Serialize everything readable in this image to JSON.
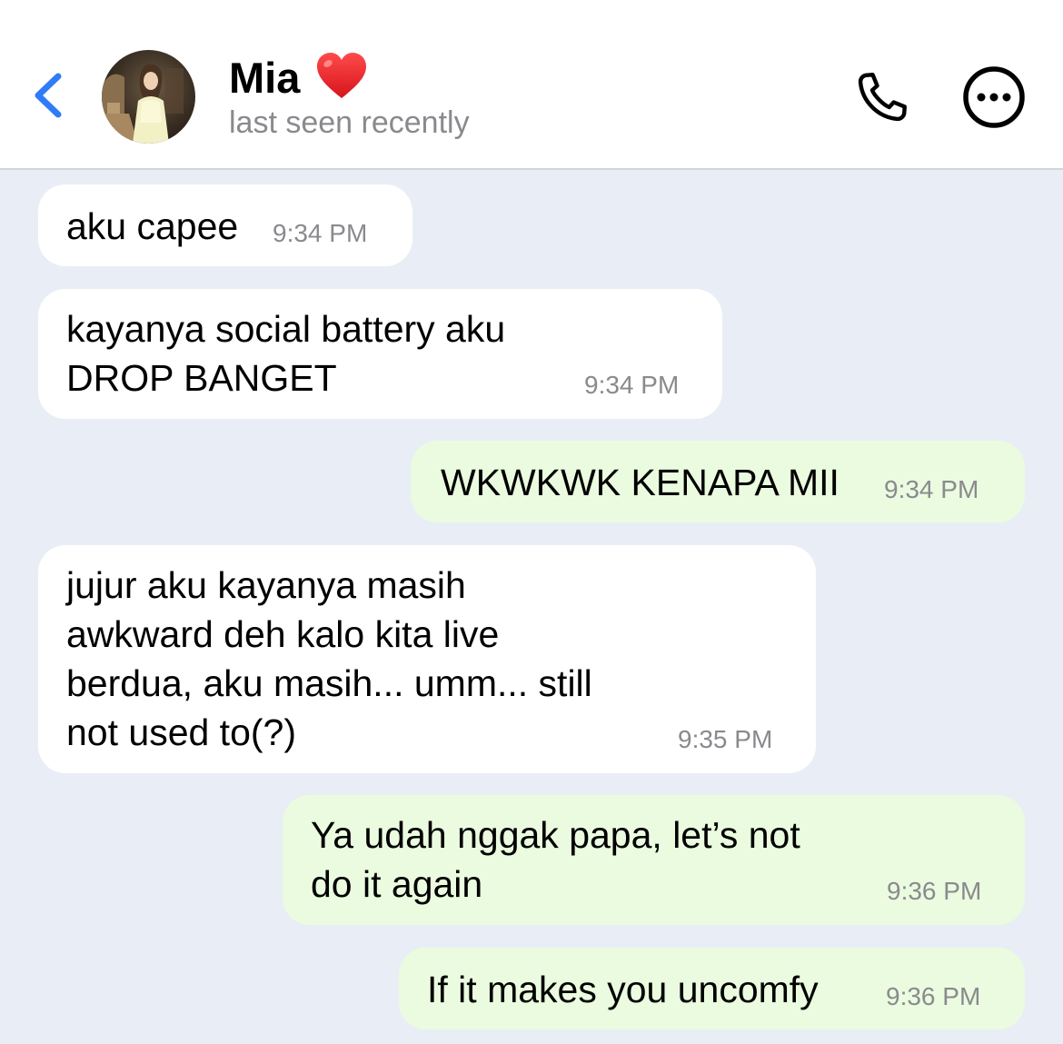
{
  "header": {
    "contact_name": "Mia",
    "status": "last seen recently",
    "accent_color": "#2f7cf6"
  },
  "icons": {
    "back": "chevron-left-icon",
    "name_badge": "red-heart-icon",
    "call": "phone-icon",
    "more": "ellipsis-circle-icon"
  },
  "colors": {
    "chat_background": "#e9eef6",
    "incoming_bubble": "#ffffff",
    "outgoing_bubble": "#ebfbdf"
  },
  "messages": [
    {
      "direction": "incoming",
      "lines": [
        "aku capee"
      ],
      "time": "9:34 PM"
    },
    {
      "direction": "incoming",
      "lines": [
        "kayanya social battery aku",
        "DROP BANGET"
      ],
      "time": "9:34 PM"
    },
    {
      "direction": "outgoing",
      "lines": [
        "WKWKWK KENAPA MII"
      ],
      "time": "9:34 PM"
    },
    {
      "direction": "incoming",
      "lines": [
        "jujur aku kayanya masih",
        "awkward deh kalo kita live",
        "berdua, aku masih... umm... still",
        "not used to(?)"
      ],
      "time": "9:35 PM"
    },
    {
      "direction": "outgoing",
      "lines": [
        "Ya udah nggak papa, let’s not",
        "do it again"
      ],
      "time": "9:36 PM"
    },
    {
      "direction": "outgoing",
      "lines": [
        "If it makes you uncomfy"
      ],
      "time": "9:36 PM"
    }
  ]
}
